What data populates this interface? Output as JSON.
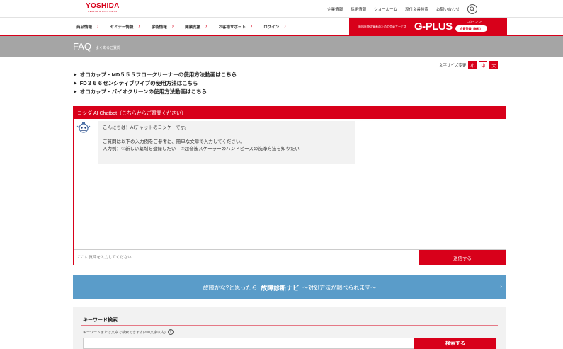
{
  "header": {
    "logo_main": "YOSHIDA",
    "logo_sub": "HEALTH & HAPPINESS",
    "top_links": [
      "企業情報",
      "採用情報",
      "ショールーム",
      "添付文書検索",
      "お問い合わせ"
    ]
  },
  "nav": {
    "items": [
      "商品情報",
      "セミナー情報",
      "学術情報",
      "開業支援",
      "お客様サポート",
      "ログイン"
    ]
  },
  "gplus": {
    "desc": "歯科医療従事者のための会員サービス",
    "logo": "G-PLUS",
    "login": "ログイン ＞",
    "register": "会員登録（無料）"
  },
  "faq": {
    "title": "FAQ",
    "subtitle": "よくあるご質問"
  },
  "font_size": {
    "label": "文字サイズ変更",
    "small": "小",
    "medium": "中",
    "large": "大"
  },
  "links": [
    "オロカップ・MD５５５フロークリーナーの使用方法動画はこちら",
    "FD３６６センシティブワイプの使用方法はこちら",
    "オロカップ・バイオクリーンの使用方法動画はこちら"
  ],
  "chat": {
    "header": "ヨシダ AI Chatbot（こちらからご質問ください）",
    "message_lines": [
      "こんにちは！AIチャットのヨシケーです。",
      "",
      "ご質問は以下の入力例をご参考に、簡単な文章で入力してください。",
      "入力例：①新しい薬剤を登録したい　②超音波スケーラーのハンドピースの洗浄方法を知りたい"
    ],
    "input_placeholder": "ここに質問を入力してください",
    "send_label": "送信する"
  },
  "banner": {
    "text_before": "故障かな?と思ったら",
    "text_strong": "故障診断ナビ",
    "text_after": "～対処方法が調べられます～",
    "arrow": "›"
  },
  "keyword_search": {
    "title": "キーワード検索",
    "description": "キーワードまたは文章で検索できます(200文字以内)",
    "help": "?",
    "button": "検索する"
  },
  "colors": {
    "brand_red": "#d8001a",
    "faq_band": "#a5a5a5",
    "banner_blue": "#5a9cc9"
  }
}
